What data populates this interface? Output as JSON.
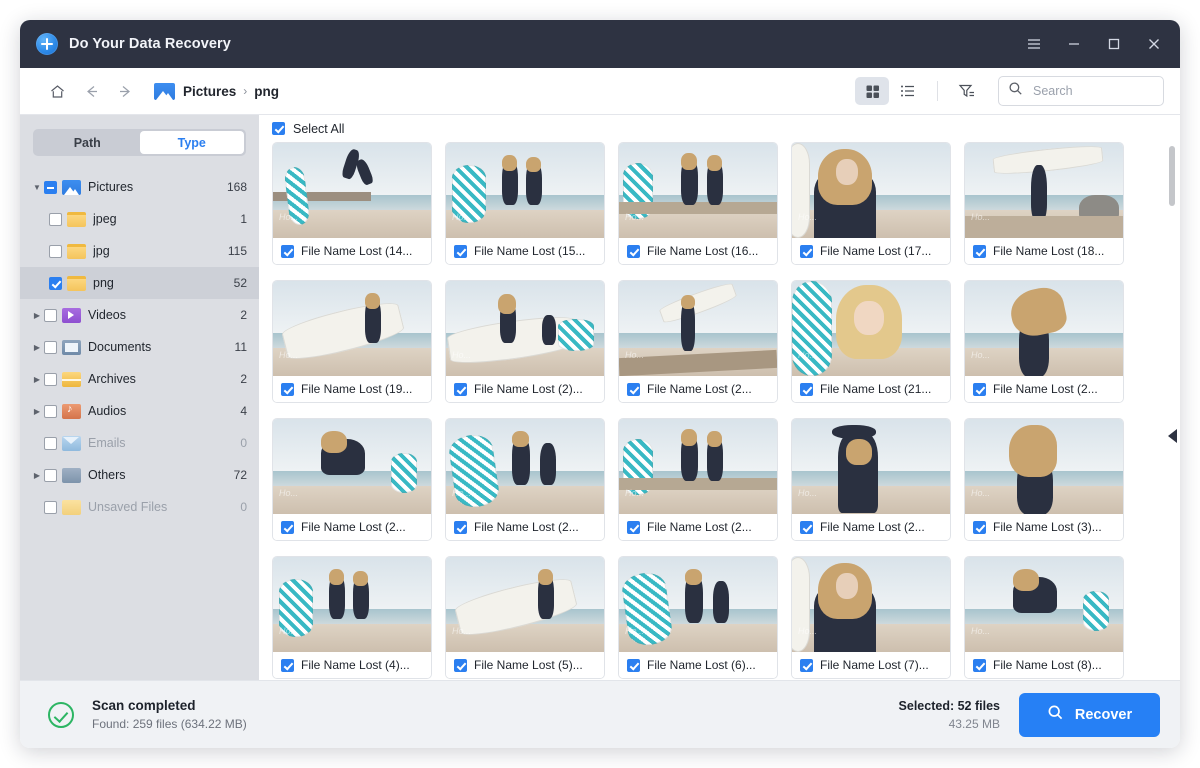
{
  "window": {
    "title": "Do Your Data Recovery",
    "logo_icon": "recovery-logo-icon",
    "controls": {
      "menu": "menu-icon",
      "minimize": "minimize-icon",
      "maximize": "maximize-icon",
      "close": "close-icon"
    }
  },
  "toolbar": {
    "home_icon": "home-icon",
    "back_icon": "back-arrow-icon",
    "forward_icon": "forward-arrow-icon",
    "folder_icon": "pictures-folder-icon",
    "breadcrumb": [
      "Pictures",
      "png"
    ],
    "separator": "›",
    "grid_view_icon": "grid-view-icon",
    "list_view_icon": "list-view-icon",
    "filter_icon": "filter-icon",
    "search_icon": "search-icon",
    "search_placeholder": "Search",
    "search_value": ""
  },
  "sidebar": {
    "tabs": [
      {
        "label": "Path",
        "active": false
      },
      {
        "label": "Type",
        "active": true
      }
    ],
    "tree": [
      {
        "label": "Pictures",
        "count": "168",
        "icon": "pictures",
        "state": "indeterminate",
        "expanded": true,
        "level": 0,
        "twisty": "▼",
        "disabled": false,
        "selected": false
      },
      {
        "label": "jpeg",
        "count": "1",
        "icon": "plain",
        "state": "unchecked",
        "expanded": false,
        "level": 1,
        "twisty": "",
        "disabled": false,
        "selected": false
      },
      {
        "label": "jpg",
        "count": "115",
        "icon": "plain",
        "state": "unchecked",
        "expanded": false,
        "level": 1,
        "twisty": "",
        "disabled": false,
        "selected": false
      },
      {
        "label": "png",
        "count": "52",
        "icon": "plain",
        "state": "checked",
        "expanded": false,
        "level": 1,
        "twisty": "",
        "disabled": false,
        "selected": true
      },
      {
        "label": "Videos",
        "count": "2",
        "icon": "videos",
        "state": "unchecked",
        "expanded": false,
        "level": 0,
        "twisty": "▶",
        "disabled": false,
        "selected": false
      },
      {
        "label": "Documents",
        "count": "11",
        "icon": "docs",
        "state": "unchecked",
        "expanded": false,
        "level": 0,
        "twisty": "▶",
        "disabled": false,
        "selected": false
      },
      {
        "label": "Archives",
        "count": "2",
        "icon": "archives",
        "state": "unchecked",
        "expanded": false,
        "level": 0,
        "twisty": "▶",
        "disabled": false,
        "selected": false
      },
      {
        "label": "Audios",
        "count": "4",
        "icon": "audios",
        "state": "unchecked",
        "expanded": false,
        "level": 0,
        "twisty": "▶",
        "disabled": false,
        "selected": false
      },
      {
        "label": "Emails",
        "count": "0",
        "icon": "emails",
        "state": "unchecked",
        "expanded": false,
        "level": 0,
        "twisty": "",
        "disabled": true,
        "selected": false
      },
      {
        "label": "Others",
        "count": "72",
        "icon": "others",
        "state": "unchecked",
        "expanded": false,
        "level": 0,
        "twisty": "▶",
        "disabled": false,
        "selected": false
      },
      {
        "label": "Unsaved Files",
        "count": "0",
        "icon": "unsaved",
        "state": "unchecked",
        "expanded": false,
        "level": 0,
        "twisty": "",
        "disabled": true,
        "selected": false
      }
    ]
  },
  "content": {
    "select_all_label": "Select All",
    "select_all_checked": true,
    "panel_toggle_icon": "collapse-preview-panel-icon",
    "files": [
      {
        "name": "File Name Lost (14...",
        "checked": true,
        "scene": "jump-pier"
      },
      {
        "name": "File Name Lost (15...",
        "checked": true,
        "scene": "two-sitting"
      },
      {
        "name": "File Name Lost (16...",
        "checked": true,
        "scene": "two-wall"
      },
      {
        "name": "File Name Lost (17...",
        "checked": true,
        "scene": "portrait"
      },
      {
        "name": "File Name Lost (18...",
        "checked": true,
        "scene": "carry-board"
      },
      {
        "name": "File Name Lost (19...",
        "checked": true,
        "scene": "board-lean"
      },
      {
        "name": "File Name Lost (2)...",
        "checked": true,
        "scene": "two-board"
      },
      {
        "name": "File Name Lost (2...",
        "checked": true,
        "scene": "walk-log"
      },
      {
        "name": "File Name Lost (21...",
        "checked": true,
        "scene": "smiling"
      },
      {
        "name": "File Name Lost (2...",
        "checked": true,
        "scene": "windy-hair"
      },
      {
        "name": "File Name Lost (2...",
        "checked": true,
        "scene": "kneel-sand"
      },
      {
        "name": "File Name Lost (2...",
        "checked": true,
        "scene": "check-board"
      },
      {
        "name": "File Name Lost (2...",
        "checked": true,
        "scene": "two-wall"
      },
      {
        "name": "File Name Lost (2...",
        "checked": true,
        "scene": "arm-up"
      },
      {
        "name": "File Name Lost (3)...",
        "checked": true,
        "scene": "back-hair"
      },
      {
        "name": "File Name Lost (4)...",
        "checked": true,
        "scene": "two-sitting"
      },
      {
        "name": "File Name Lost (5)...",
        "checked": true,
        "scene": "board-lean"
      },
      {
        "name": "File Name Lost (6)...",
        "checked": true,
        "scene": "check-board"
      },
      {
        "name": "File Name Lost (7)...",
        "checked": true,
        "scene": "portrait"
      },
      {
        "name": "File Name Lost (8)...",
        "checked": true,
        "scene": "kneel-sand"
      }
    ]
  },
  "status": {
    "icon": "success-check-icon",
    "title": "Scan completed",
    "subtitle": "Found: 259 files (634.22 MB)",
    "selected_count": "Selected: 52 files",
    "selected_size": "43.25 MB",
    "recover_label": "Recover",
    "recover_icon": "search-icon"
  },
  "colors": {
    "accent": "#2680f5",
    "titlebar": "#2e3342",
    "sidebar": "#dcdee3",
    "success": "#2cb563"
  }
}
